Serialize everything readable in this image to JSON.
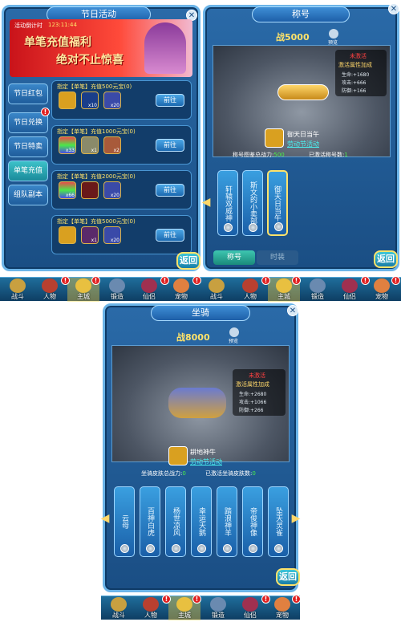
{
  "festival": {
    "title": "节日活动",
    "countdown_label": "活动倒计时",
    "countdown_value": "123:11:44",
    "banner_line1": "单笔充值福利",
    "banner_line2": "绝对不止惊喜",
    "tabs": [
      "节日红包",
      "节日兑换",
      "节日特卖",
      "单笔充值",
      "组队副本"
    ],
    "rows": [
      {
        "title": "指定【单笔】充值500元宝(0)",
        "items": [
          {
            "count": ""
          },
          {
            "count": "x10"
          },
          {
            "count": "x20"
          }
        ],
        "button": "前往"
      },
      {
        "title": "指定【单笔】充值1000元宝(0)",
        "items": [
          {
            "count": "x33"
          },
          {
            "count": "x1"
          },
          {
            "count": "x2"
          }
        ],
        "button": "前往"
      },
      {
        "title": "指定【单笔】充值2000元宝(0)",
        "items": [
          {
            "count": "x66"
          },
          {
            "count": ""
          },
          {
            "count": "x20"
          }
        ],
        "button": "前往"
      },
      {
        "title": "指定【单笔】充值5000元宝(0)",
        "items": [
          {
            "count": ""
          },
          {
            "count": "x1"
          },
          {
            "count": "x20"
          }
        ],
        "button": "前往"
      }
    ],
    "back": "返回"
  },
  "title_panel": {
    "title": "称号",
    "power": "战5000",
    "preview_label": "预览",
    "status": "未激活",
    "bonus_label": "激活属性加成",
    "stats": [
      "生命:+1680",
      "攻击:+666",
      "防御:+166"
    ],
    "name": "御天日当午",
    "source": "劳动节活动",
    "total_label": "称号图鉴总战力:",
    "total_value": "500",
    "activated_label": "已激活称号数:",
    "activated_value": "1",
    "cards": [
      "轩辕双威神",
      "斯文的小卖部",
      "御天日当午"
    ],
    "tab_title": "称号",
    "tab_fashion": "时装",
    "back": "返回"
  },
  "mount_panel": {
    "title": "坐骑",
    "power": "战8000",
    "preview_label": "预览",
    "status": "未激活",
    "bonus_label": "激活属性加成",
    "stats": [
      "生命:+2680",
      "攻击:+1066",
      "防御:+266"
    ],
    "name": "耕地神牛",
    "source": "劳动节活动",
    "total_label": "坐骑皮肤总战力:",
    "total_value": "0",
    "activated_label": "已激活坐骑皮肤数:",
    "activated_value": "0",
    "cards": [
      "云母",
      "百神白虎",
      "杨世凉风",
      "幸运天鹅",
      "踏浪神羊",
      "帝俊神像",
      "坠天灵雀"
    ],
    "back": "返回"
  },
  "nav": [
    "战斗",
    "人物",
    "主城",
    "锻造",
    "仙侣",
    "宠物"
  ]
}
